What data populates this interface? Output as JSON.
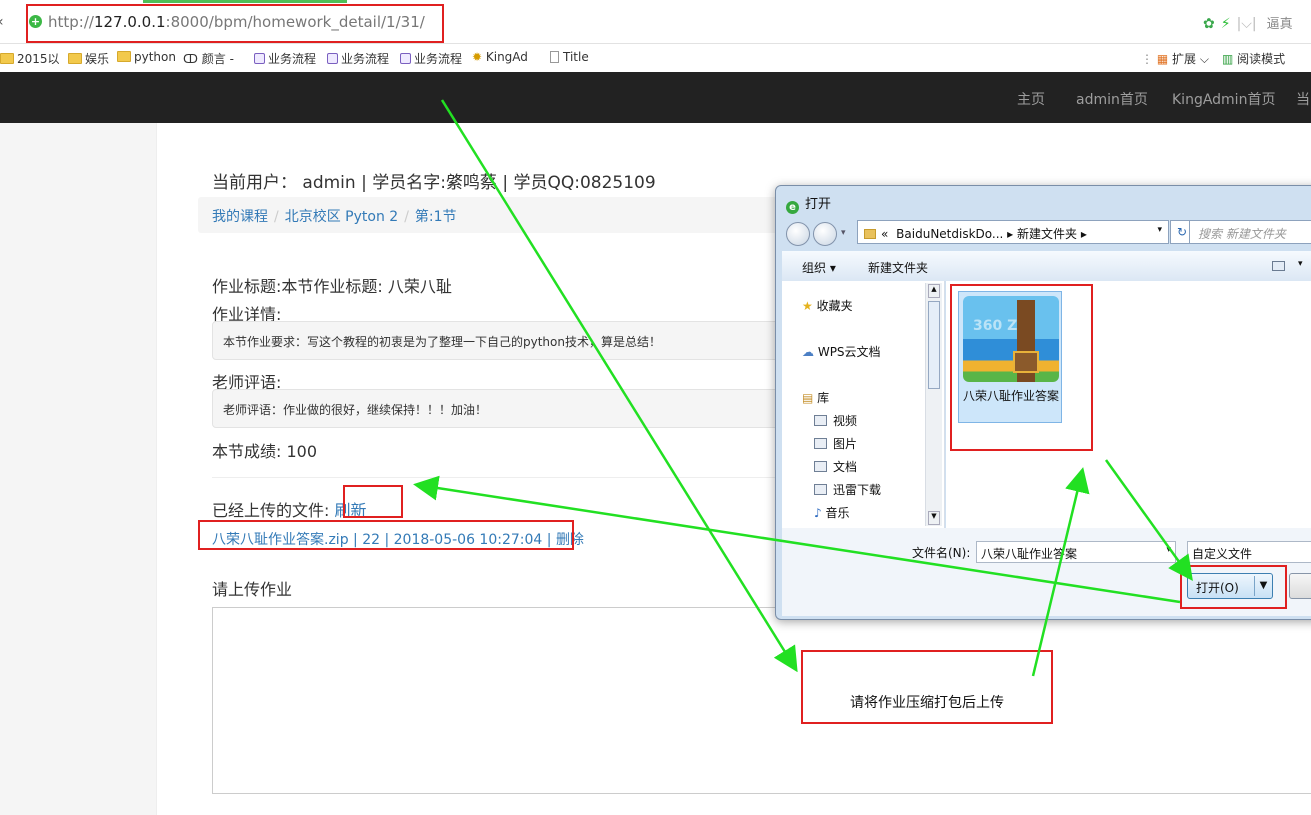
{
  "browser": {
    "back_icon": "back-arrow-icon",
    "url_scheme": "http://",
    "url_host": "127.0.0.1",
    "url_rest": ":8000/bpm/homework_detail/1/31/",
    "search_hint": "逼真",
    "bookmarks": [
      {
        "label": "2015以",
        "icon": "folder-icon"
      },
      {
        "label": "娱乐",
        "icon": "folder-icon"
      },
      {
        "label": "python",
        "icon": "folder-icon"
      },
      {
        "label": "颜言 -",
        "icon": "bookmark-icon"
      },
      {
        "label": "业务流程",
        "icon": "bookmark-icon"
      },
      {
        "label": "业务流程",
        "icon": "bookmark-icon"
      },
      {
        "label": "业务流程",
        "icon": "bookmark-icon"
      },
      {
        "label": "KingAd",
        "icon": "bookmark-icon"
      },
      {
        "label": "Title",
        "icon": "page-icon"
      }
    ],
    "extensions_label": "扩展",
    "reading_mode_label": "阅读模式"
  },
  "navbar": {
    "links": [
      "主页",
      "admin首页",
      "KingAdmin首页",
      "当"
    ]
  },
  "page": {
    "user_line": "当前用户： admin | 学员名字:綮鸣蔡 | 学员QQ:0825109",
    "breadcrumb": [
      "我的课程",
      "北京校区 Pyton 2",
      "第:1节"
    ],
    "homework_title": "作业标题:本节作业标题: 八荣八耻",
    "detail_label": "作业详情:",
    "detail_text": "本节作业要求：写这个教程的初衷是为了整理一下自己的python技术，算是总结！",
    "comment_label": "老师评语:",
    "comment_text": "老师评语：作业做的很好，继续保持！！！加油！",
    "score_label": "本节成绩: ",
    "score_value": "100",
    "uploaded_label": "已经上传的文件:",
    "refresh_link": "刷新",
    "uploaded_file": "八荣八耻作业答案.zip | 22 | 2018-05-06 10:27:04 | ",
    "delete_link": "删除",
    "upload_heading": "请上传作业"
  },
  "dialog": {
    "title": "打开",
    "path_prefix": "«",
    "path_items": [
      "BaiduNetdiskDo...",
      "新建文件夹"
    ],
    "search_placeholder": "搜索 新建文件夹",
    "toolbar": {
      "organize": "组织 ▾",
      "new_folder": "新建文件夹"
    },
    "nav": [
      {
        "label": "收藏夹",
        "icon": "star-icon"
      },
      {
        "label": "WPS云文档",
        "icon": "cloud-icon"
      },
      {
        "label": "库",
        "icon": "library-icon"
      },
      {
        "label": "视频",
        "icon": "video-icon"
      },
      {
        "label": "图片",
        "icon": "picture-icon"
      },
      {
        "label": "文档",
        "icon": "document-icon"
      },
      {
        "label": "迅雷下载",
        "icon": "download-icon"
      },
      {
        "label": "音乐",
        "icon": "music-icon"
      }
    ],
    "file": {
      "name": "八荣八耻作业答案",
      "icon_text": "360 ZIP"
    },
    "filename_label": "文件名(N):",
    "filename_value": "八荣八耻作业答案",
    "filetype_value": "自定义文件",
    "open_button": "打开(O)"
  },
  "annotation": {
    "note": "请将作业压缩打包后上传",
    "highlight_color": "#e02020",
    "arrow_color": "#22e022"
  }
}
